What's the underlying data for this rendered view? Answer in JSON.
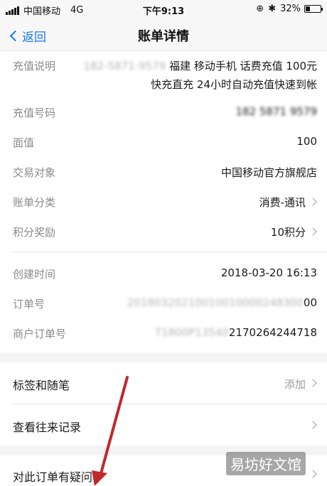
{
  "status_bar": {
    "carrier": "中国移动",
    "network": "4G",
    "time": "下午9:13",
    "battery": "32%",
    "battery_level": 0.32
  },
  "nav": {
    "back_label": "返回",
    "title": "账单详情"
  },
  "details": {
    "recharge_desc_label": "充值说明",
    "recharge_desc_redacted": "182-5871-9579",
    "recharge_desc_line1": "福建 移动手机 话费充值 100元",
    "recharge_desc_line2": "快充直充 24小时自动充值快速到帐",
    "recharge_number_label": "充值号码",
    "recharge_number_value": "182 5871 9579",
    "face_value_label": "面值",
    "face_value": "100",
    "counterparty_label": "交易对象",
    "counterparty_value": "中国移动官方旗舰店",
    "category_label": "账单分类",
    "category_value": "消费-通讯",
    "points_label": "积分奖励",
    "points_value": "10积分",
    "created_label": "创建时间",
    "created_value": "2018-03-20 16:13",
    "order_no_label": "订单号",
    "order_no_redacted": "20180320210010010000248300",
    "order_no_tail": "00",
    "merchant_order_label": "商户订单号",
    "merchant_order_redacted": "T1800P13540",
    "merchant_order_tail": "2170264244718"
  },
  "actions": {
    "tags_label": "标签和随笔",
    "tags_value": "添加",
    "history_label": "查看往来记录",
    "question_label": "对此订单有疑问"
  },
  "watermark": "易坊好文馆"
}
